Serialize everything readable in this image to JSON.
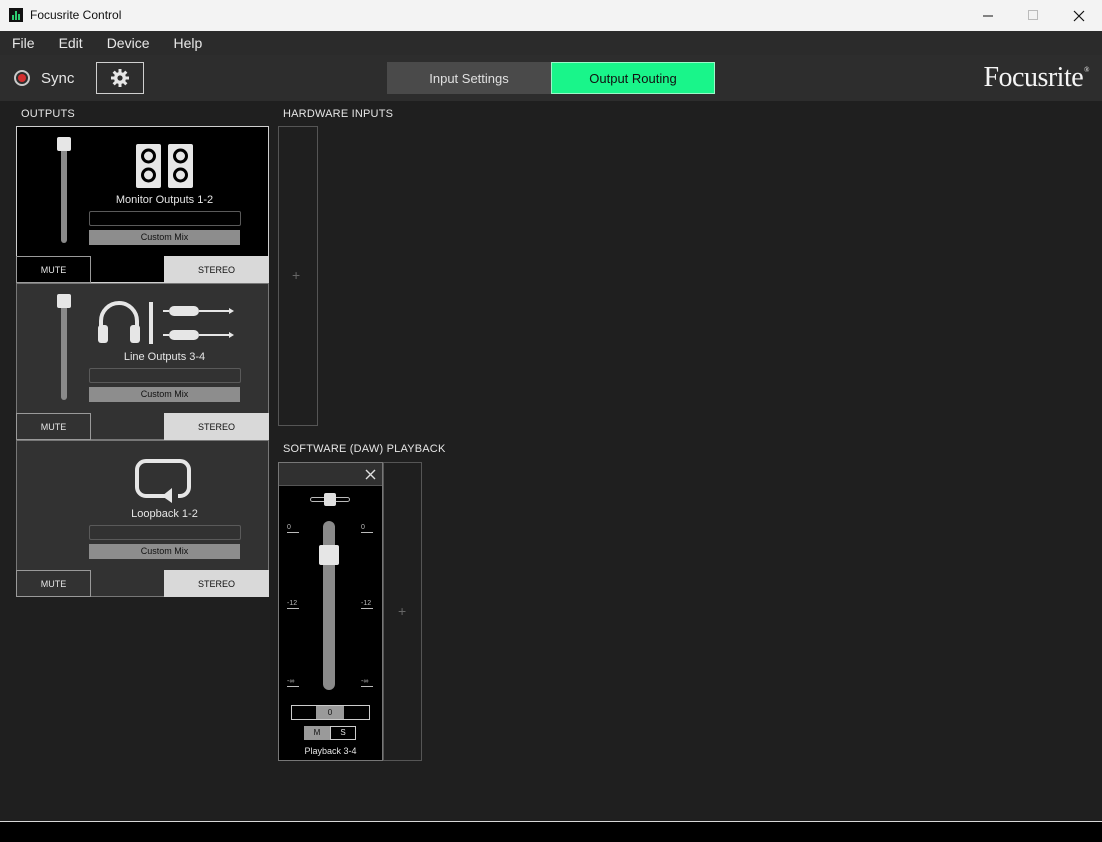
{
  "window": {
    "title": "Focusrite Control"
  },
  "menu": [
    "File",
    "Edit",
    "Device",
    "Help"
  ],
  "toolbar": {
    "sync_label": "Sync",
    "sync_color": "#d32f2f",
    "tabs": {
      "input": "Input Settings",
      "output": "Output Routing"
    },
    "accent_color": "#19f58a",
    "brand": "Focusrite",
    "brand_mark": "®"
  },
  "outputs": {
    "title": "OUTPUTS",
    "cards": [
      {
        "name": "Monitor Outputs 1-2",
        "icon": "speakers-icon",
        "mix": "Custom Mix",
        "mute": "MUTE",
        "stereo": "STEREO",
        "selected": true
      },
      {
        "name": "Line Outputs 3-4",
        "icon": "headphones-line-icon",
        "mix": "Custom Mix",
        "mute": "MUTE",
        "stereo": "STEREO",
        "selected": false
      },
      {
        "name": "Loopback 1-2",
        "icon": "loopback-icon",
        "mix": "Custom Mix",
        "mute": "MUTE",
        "stereo": "STEREO",
        "selected": false
      }
    ]
  },
  "hardware_inputs": {
    "title": "HARDWARE INPUTS",
    "add": "+"
  },
  "playback": {
    "title": "SOFTWARE (DAW) PLAYBACK",
    "scale": [
      "0",
      "-12",
      "-∞"
    ],
    "gain": "0",
    "mute": "M",
    "solo": "S",
    "name": "Playback 3-4",
    "add": "+"
  }
}
